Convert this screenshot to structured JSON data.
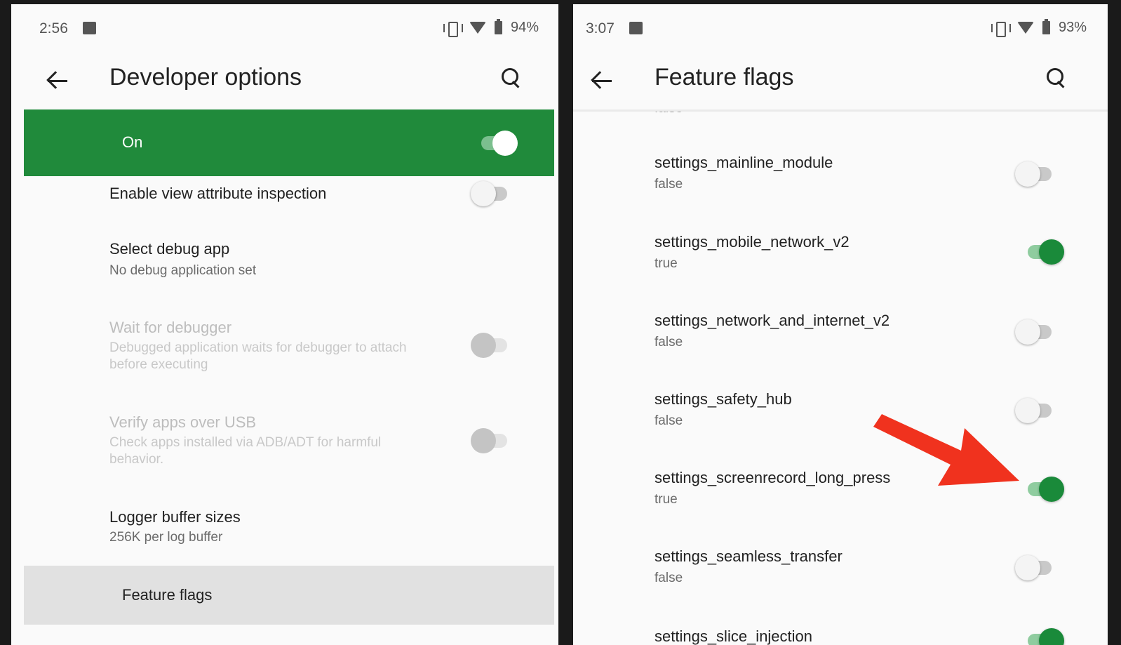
{
  "left_screen": {
    "status": {
      "time": "2:56",
      "battery": "94%"
    },
    "title": "Developer options",
    "master_switch": {
      "label": "On",
      "state": "on"
    },
    "items": [
      {
        "title": "Enable view attribute inspection",
        "subtitle": "",
        "toggle": "off"
      },
      {
        "title": "Select debug app",
        "subtitle": "No debug application set",
        "toggle": "none"
      },
      {
        "title": "Wait for debugger",
        "subtitle": "Debugged application waits for debugger to attach before executing",
        "toggle": "disabled"
      },
      {
        "title": "Verify apps over USB",
        "subtitle": "Check apps installed via ADB/ADT for harmful behavior.",
        "toggle": "disabled"
      },
      {
        "title": "Logger buffer sizes",
        "subtitle": "256K per log buffer",
        "toggle": "none"
      }
    ],
    "highlighted_item": "Feature flags"
  },
  "right_screen": {
    "status": {
      "time": "3:07",
      "battery": "93%"
    },
    "title": "Feature flags",
    "cut_off_top_text": "false",
    "flags": [
      {
        "name": "settings_mainline_module",
        "value": "false"
      },
      {
        "name": "settings_mobile_network_v2",
        "value": "true"
      },
      {
        "name": "settings_network_and_internet_v2",
        "value": "false"
      },
      {
        "name": "settings_safety_hub",
        "value": "false"
      },
      {
        "name": "settings_screenrecord_long_press",
        "value": "true"
      },
      {
        "name": "settings_seamless_transfer",
        "value": "false"
      },
      {
        "name": "settings_slice_injection",
        "value": ""
      }
    ]
  },
  "colors": {
    "accent_green": "#208a3b",
    "toggle_on": "#1a8a3a",
    "arrow_red": "#f0321e"
  },
  "icons": [
    "image-icon",
    "vibrate-icon",
    "wifi-icon",
    "battery-icon",
    "back-arrow-icon",
    "search-icon",
    "red-pointer-arrow"
  ]
}
